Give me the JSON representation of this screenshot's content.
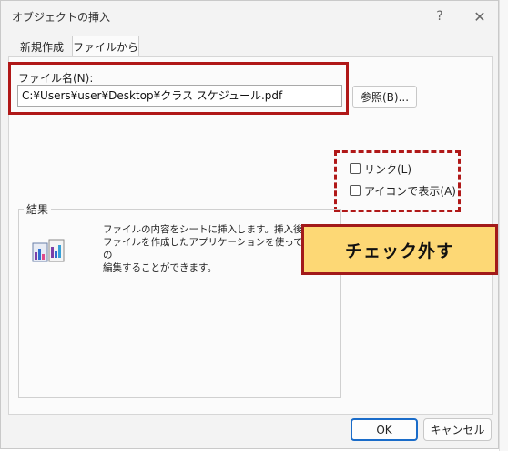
{
  "dialog": {
    "title": "オブジェクトの挿入",
    "help_label": "?",
    "close_label": "✕"
  },
  "tabs": [
    {
      "label": "新規作成"
    },
    {
      "label": "ファイルから"
    }
  ],
  "file": {
    "label": "ファイル名(N):",
    "value": "C:¥Users¥user¥Desktop¥クラス スケジュール.pdf",
    "browse_label": "参照(B)..."
  },
  "options": {
    "link_label": "リンク(L)",
    "link_checked": false,
    "icon_label": "アイコンで表示(A)",
    "icon_checked": false
  },
  "result": {
    "label": "結果",
    "line1": "ファイルの内容をシートに挿入します。挿入後、",
    "line2": "ファイルを作成したアプリケーションを使って、この",
    "line3": "編集することができます。"
  },
  "callout": {
    "text": "チェック外す",
    "bg_color": "#fdd875",
    "border_color": "#a21a1a"
  },
  "footer": {
    "ok_label": "OK",
    "cancel_label": "キャンセル"
  },
  "highlight_color": "#b01818"
}
